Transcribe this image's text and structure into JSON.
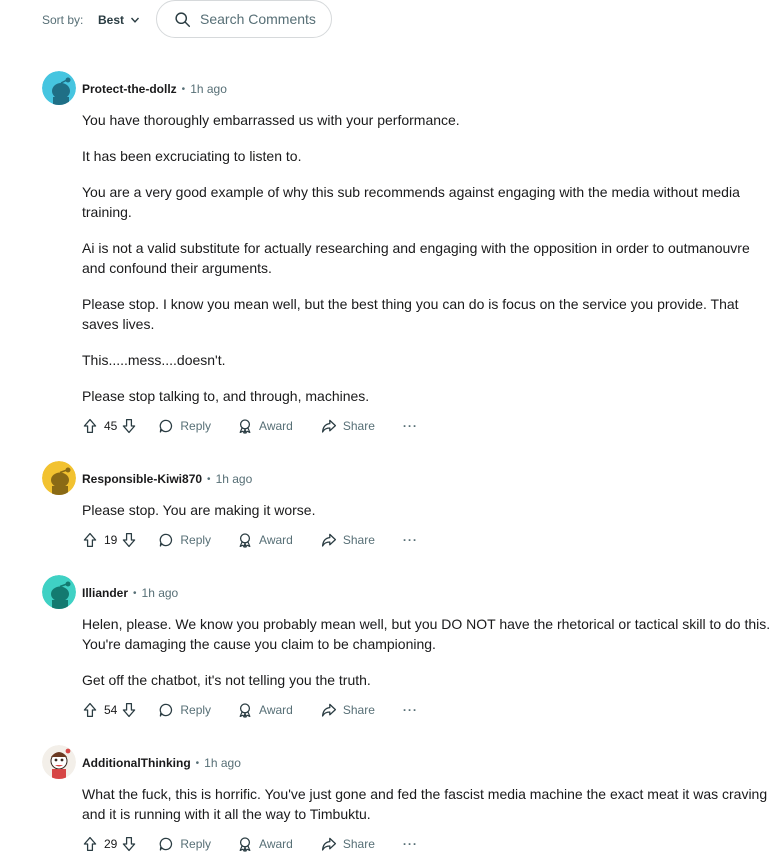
{
  "sort": {
    "label": "Sort by:",
    "value": "Best"
  },
  "search": {
    "placeholder": "Search Comments"
  },
  "actions": {
    "reply": "Reply",
    "award": "Award",
    "share": "Share",
    "more": "···"
  },
  "comments": [
    {
      "author": "Protect-the-dollz",
      "time": "1h ago",
      "votes": "45",
      "paragraphs": [
        "You have thoroughly embarrassed us with your performance.",
        "It has been excruciating to listen to.",
        "You are a very good example of why this sub recommends against engaging with the media without media training.",
        "Ai is not a valid substitute for actually researching and engaging with the opposition in order to outmanouvre and confound their arguments.",
        "Please stop. I know you mean well, but the best thing you can do is focus on the service you provide. That saves lives.",
        "This.....mess....doesn't.",
        "Please stop talking to, and through, machines."
      ]
    },
    {
      "author": "Responsible-Kiwi870",
      "time": "1h ago",
      "votes": "19",
      "paragraphs": [
        "Please stop. You are making it worse."
      ]
    },
    {
      "author": "Illiander",
      "time": "1h ago",
      "votes": "54",
      "paragraphs": [
        "Helen, please. We know you probably mean well, but you DO NOT have the rhetorical or tactical skill to do this. You're damaging the cause you claim to be championing.",
        "Get off the chatbot, it's not telling you the truth."
      ]
    },
    {
      "author": "AdditionalThinking",
      "time": "1h ago",
      "votes": "29",
      "paragraphs": [
        "What the fuck, this is horrific. You've just gone and fed the fascist media machine the exact meat it was craving and it is running with it all the way to Timbuktu."
      ]
    }
  ],
  "colors": {
    "avatar_teal": "#3fd1c4",
    "avatar_cyan": "#46c5e0",
    "avatar_yellow": "#f2c230",
    "muted": "#576f76"
  }
}
